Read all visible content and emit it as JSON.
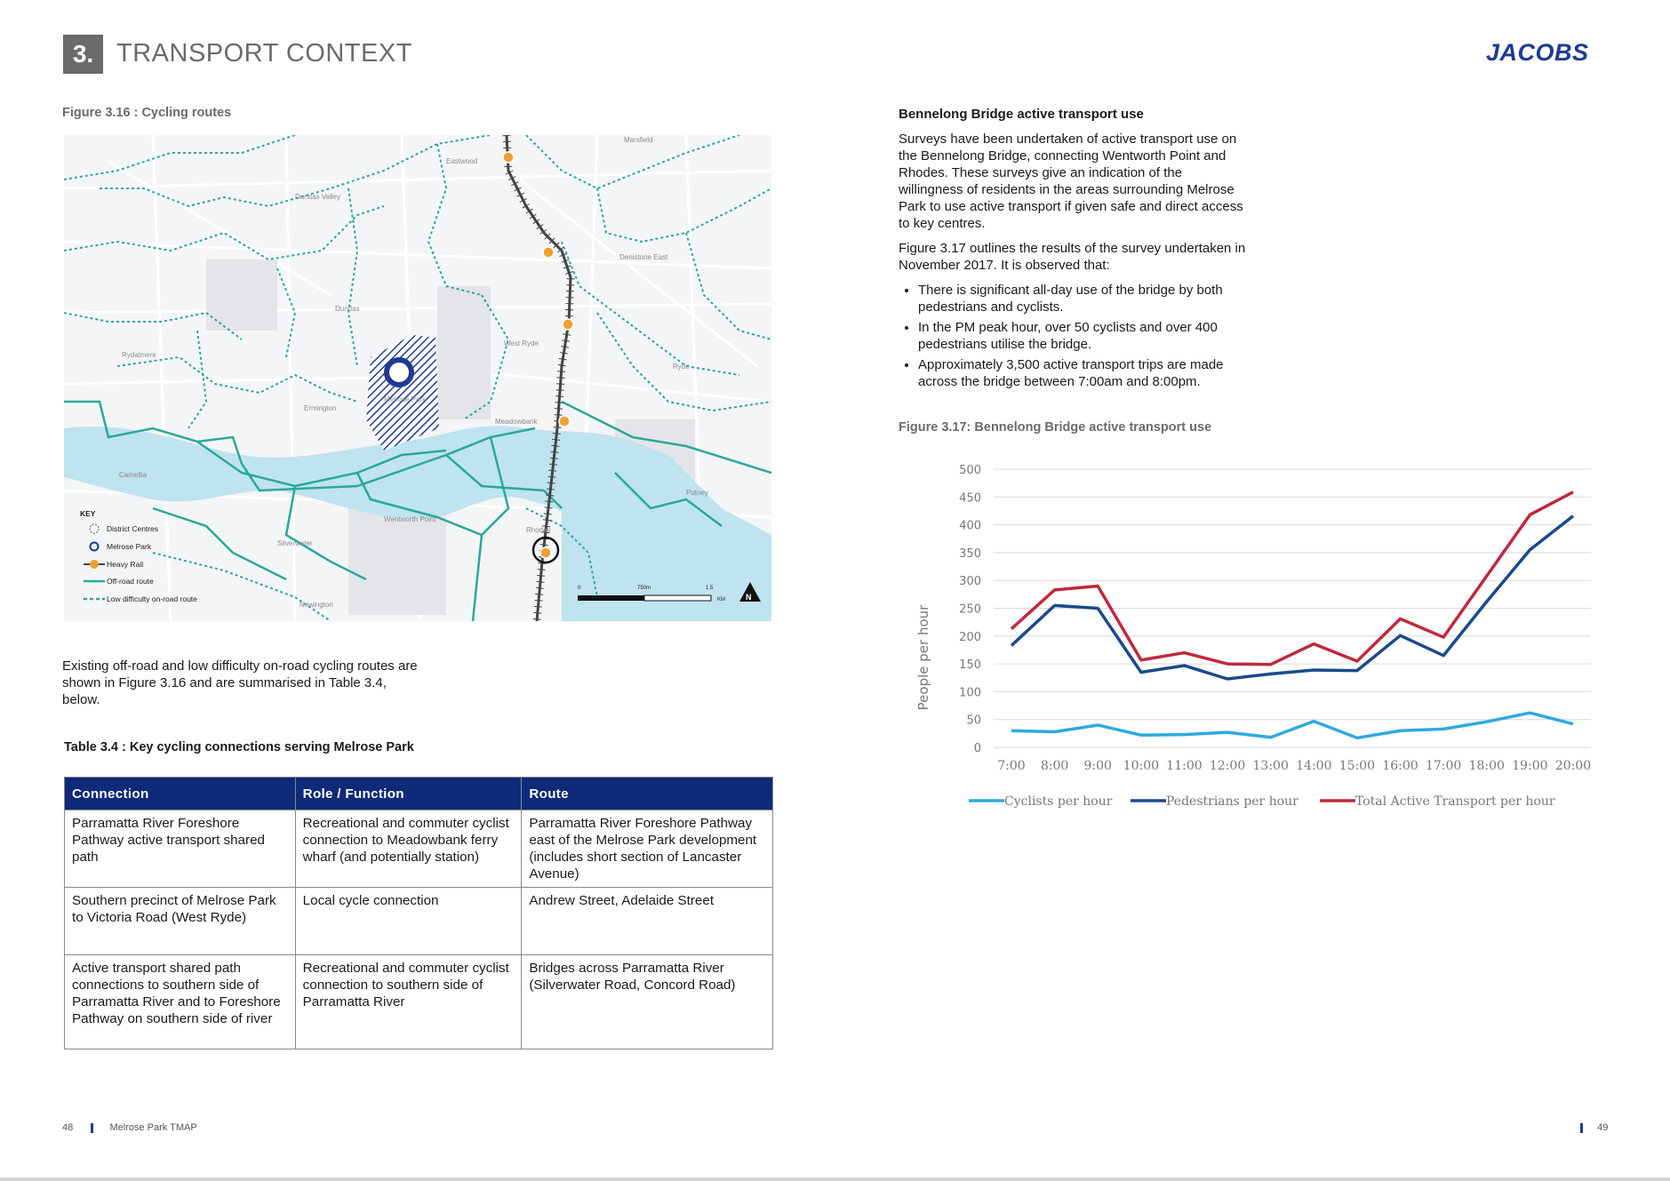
{
  "header": {
    "section_number": "3.",
    "section_title": "TRANSPORT CONTEXT",
    "logo_text": "JACOBS"
  },
  "left": {
    "figure_caption": "Figure 3.16 : Cycling routes",
    "map": {
      "key_title": "KEY",
      "legend": [
        {
          "label": "District Centres",
          "icon": "dashed-circle-icon"
        },
        {
          "label": "Melrose Park",
          "icon": "circle-ring-icon"
        },
        {
          "label": "Heavy Rail",
          "icon": "rail-station-icon"
        },
        {
          "label": "Off-road route",
          "icon": "solid-line-icon"
        },
        {
          "label": "Low difficulty on-road route",
          "icon": "dashed-line-icon"
        }
      ],
      "place_labels": [
        "Eastwood",
        "Marsfield",
        "Denistone East",
        "Dundas Valley",
        "Dundas",
        "Ermington",
        "Rydalmere",
        "West Ryde",
        "Meadowbank",
        "Ryde",
        "Putney",
        "Rhodes",
        "Wentworth Point",
        "Camellia",
        "Silverwater",
        "Newington",
        "Melrose Park"
      ],
      "scale": {
        "zero": "0",
        "mid": "750m",
        "end": "1.5",
        "unit": "KM"
      },
      "north_label": "N",
      "colors": {
        "off_road": "#2aa89a",
        "on_road": "#2aa89a",
        "water": "#bfe3ef",
        "rail": "#555555",
        "station": "#f0a030",
        "melrose": "#1f3a93"
      }
    },
    "intro_text": "Existing off-road and low difficulty on-road cycling routes are shown in Figure 3.16 and are summarised in Table 3.4, below.",
    "table_caption": "Table 3.4 : Key cycling connections serving Melrose Park",
    "table": {
      "headers": [
        "Connection",
        "Role / Function",
        "Route"
      ],
      "rows": [
        [
          "Parramatta River Foreshore Pathway active transport shared path",
          "Recreational and commuter cyclist connection to Meadowbank ferry wharf (and potentially station)",
          "Parramatta River Foreshore Pathway east of the Melrose Park development (includes short section of Lancaster Avenue)"
        ],
        [
          "Southern precinct of Melrose Park to Victoria Road (West Ryde)",
          "Local cycle connection",
          "Andrew Street, Adelaide Street"
        ],
        [
          "Active transport shared path connections to southern side of Parramatta River and to Foreshore Pathway on southern side of river",
          "Recreational and commuter cyclist connection to southern side of Parramatta River",
          "Bridges across Parramatta River (Silverwater Road, Concord Road)"
        ]
      ]
    }
  },
  "right": {
    "heading": "Bennelong Bridge active transport use",
    "para1": "Surveys have been undertaken of active transport use on the Bennelong Bridge, connecting Wentworth Point and Rhodes. These surveys give an indication of the willingness of residents in the areas surrounding Melrose Park to use active transport if given safe and direct access to key centres.",
    "para2": "Figure 3.17 outlines the results of the survey undertaken in November 2017. It is observed that:",
    "bullets": [
      "There is significant all-day use of the bridge by both pedestrians and cyclists.",
      "In the PM peak hour, over 50 cyclists and over 400 pedestrians utilise the bridge.",
      "Approximately 3,500 active transport trips are made across the bridge between 7:00am and 8:00pm."
    ],
    "figure_caption": "Figure 3.17: Bennelong Bridge active transport use"
  },
  "chart_data": {
    "type": "line",
    "title": "",
    "xlabel": "",
    "ylabel": "People per hour",
    "categories": [
      "7:00",
      "8:00",
      "9:00",
      "10:00",
      "11:00",
      "12:00",
      "13:00",
      "14:00",
      "15:00",
      "16:00",
      "17:00",
      "18:00",
      "19:00",
      "20:00"
    ],
    "ylim": [
      0,
      500
    ],
    "yticks": [
      0,
      50,
      100,
      150,
      200,
      250,
      300,
      350,
      400,
      450,
      500
    ],
    "grid": true,
    "legend_position": "bottom",
    "series": [
      {
        "name": "Cyclists per hour",
        "color": "#2eaae1",
        "values": [
          30,
          28,
          40,
          22,
          23,
          27,
          18,
          47,
          17,
          30,
          33,
          46,
          62,
          42
        ]
      },
      {
        "name": "Pedestrians per hour",
        "color": "#1a4a8c",
        "values": [
          183,
          255,
          250,
          135,
          147,
          123,
          132,
          139,
          138,
          201,
          165,
          262,
          355,
          416
        ]
      },
      {
        "name": "Total Active Transport per hour",
        "color": "#c0283c",
        "values": [
          213,
          283,
          290,
          157,
          170,
          150,
          149,
          186,
          155,
          231,
          198,
          308,
          418,
          459
        ]
      }
    ]
  },
  "footer": {
    "left_page": "48",
    "doc_name": "Melrose Park TMAP",
    "right_page": "49"
  }
}
